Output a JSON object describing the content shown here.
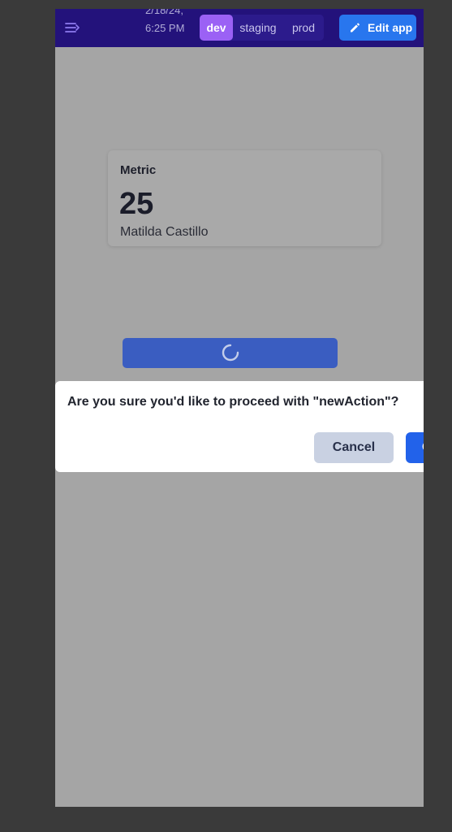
{
  "topbar": {
    "menu_icon": "menu-collapse-icon",
    "timestamp": "2/18/24, 6:25 PM",
    "environments": [
      "dev",
      "staging",
      "prod"
    ],
    "active_environment": "dev",
    "edit_button": {
      "label": "Edit app",
      "icon": "pencil-icon"
    }
  },
  "metric": {
    "title": "Metric",
    "value": "25",
    "subtitle": "Matilda Castillo"
  },
  "action_button": {
    "state": "loading",
    "icon": "spinner-icon"
  },
  "dialog": {
    "message": "Are you sure you'd like to proceed with \"newAction\"?",
    "cancel_label": "Cancel",
    "confirm_label": "OK"
  },
  "colors": {
    "topbar_bg": "#23127b",
    "env_active": "#9b61f5",
    "edit_button": "#2876ee",
    "confirm_button": "#2262ea",
    "cancel_button": "#c9d1e2",
    "overlay": "#a5a5a5"
  }
}
